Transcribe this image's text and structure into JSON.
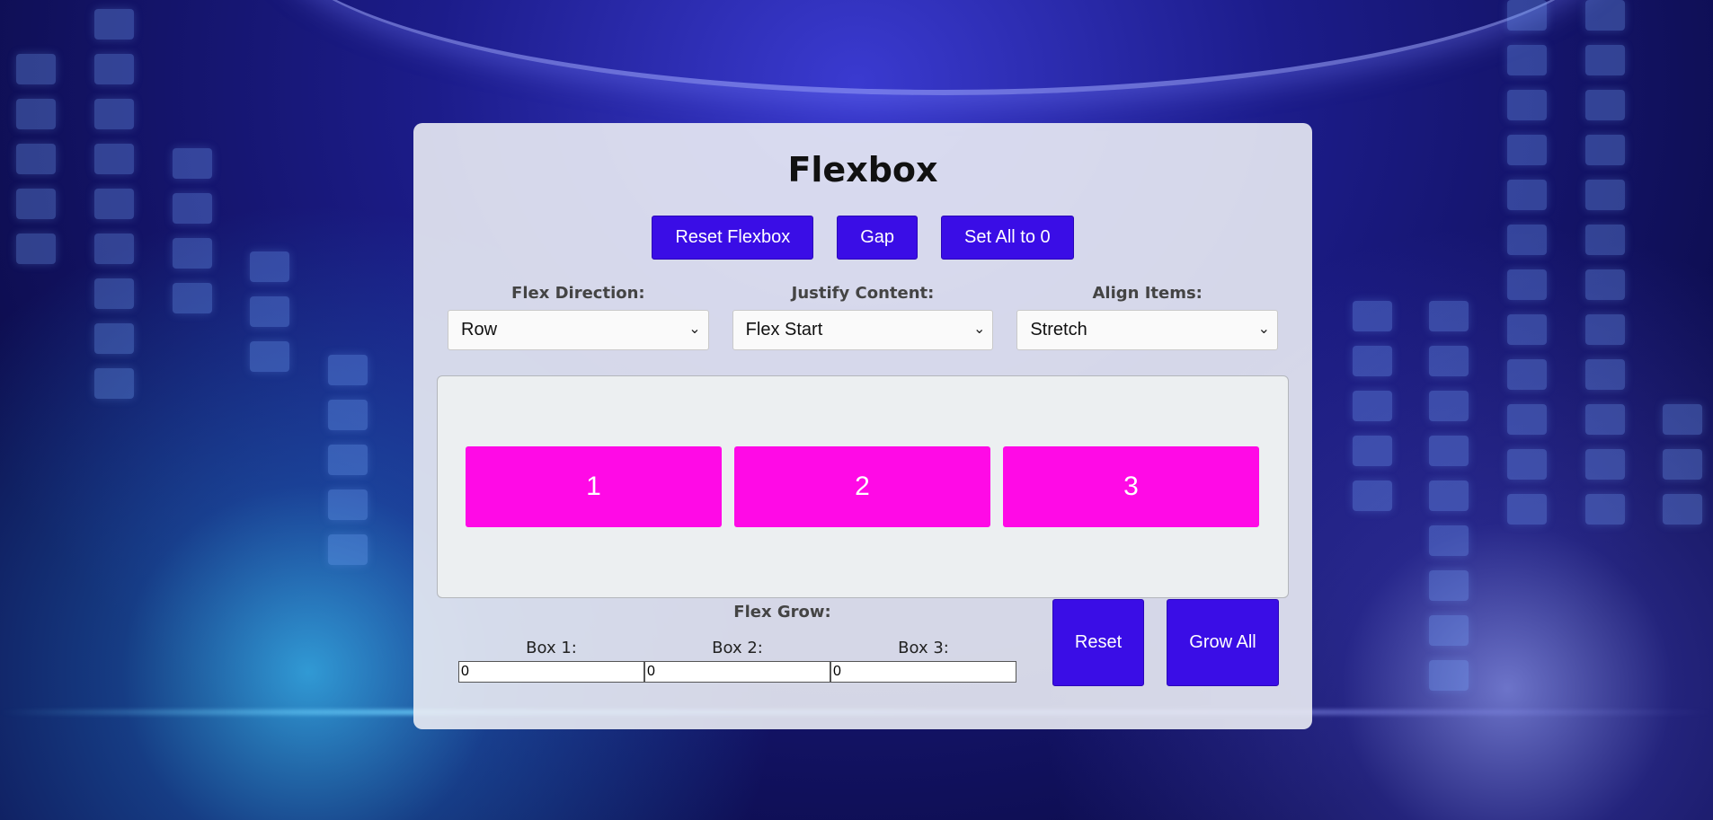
{
  "panel": {
    "title": "Flexbox"
  },
  "toolbar": {
    "reset_flexbox_label": "Reset Flexbox",
    "gap_label": "Gap",
    "set_all_zero_label": "Set All to 0"
  },
  "controls": {
    "flex_direction": {
      "label": "Flex Direction:",
      "value": "Row"
    },
    "justify_content": {
      "label": "Justify Content:",
      "value": "Flex Start"
    },
    "align_items": {
      "label": "Align Items:",
      "value": "Stretch"
    }
  },
  "boxes": [
    "1",
    "2",
    "3"
  ],
  "flex_grow": {
    "title": "Flex Grow:",
    "fields": [
      {
        "label": "Box 1:",
        "value": "0"
      },
      {
        "label": "Box 2:",
        "value": "0"
      },
      {
        "label": "Box 3:",
        "value": "0"
      }
    ],
    "reset_label": "Reset",
    "grow_all_label": "Grow All"
  },
  "colors": {
    "button": "#3a0de6",
    "box": "#ff0ae6",
    "panel": "#eaecf4"
  },
  "icons": {
    "select_chevron": "chevron-down-icon"
  }
}
